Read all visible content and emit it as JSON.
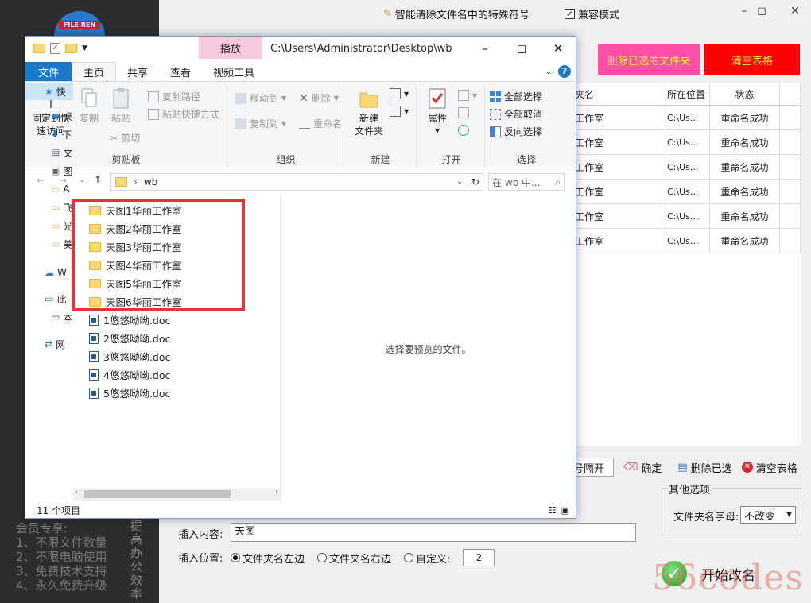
{
  "app": {
    "logo_text": "FILE REN",
    "special_symbols_label": "智能清除文件名中的特殊符号",
    "compat_mode_label": "兼容模式",
    "compat_mode_checked": true,
    "delete_selected_folders": "删除已选的文件夹",
    "clear_table_top": "清空表格",
    "table": {
      "headers": [
        "夹名",
        "所在位置",
        "状态"
      ],
      "rows": [
        {
          "name": "工作室",
          "location": "C:\\Us...",
          "status": "重命名成功"
        },
        {
          "name": "工作室",
          "location": "C:\\Us...",
          "status": "重命名成功"
        },
        {
          "name": "工作室",
          "location": "C:\\Us...",
          "status": "重命名成功"
        },
        {
          "name": "工作室",
          "location": "C:\\Us...",
          "status": "重命名成功"
        },
        {
          "name": "工作室",
          "location": "C:\\Us...",
          "status": "重命名成功"
        },
        {
          "name": "工作室",
          "location": "C:\\Us...",
          "status": "重命名成功"
        }
      ]
    },
    "toolbar": {
      "separator_value": "号隔开",
      "confirm": "确定",
      "delete_selected": "删除已选",
      "clear_table": "清空表格"
    },
    "other_options": {
      "legend": "其他选项",
      "font_label": "文件夹名字母:",
      "font_value": "不改变"
    },
    "insert": {
      "content_label": "插入内容:",
      "content_value": "天图",
      "position_label": "插入位置:",
      "option_left": "文件夹名左边",
      "option_right": "文件夹名右边",
      "option_custom": "自定义:",
      "custom_value": "2",
      "selected": "left"
    },
    "start_label": "开始改名",
    "vip_lines": [
      "会员专享:",
      "1、不限文件数量",
      "2、不限电脑使用",
      "3、免费技术支持",
      "4、永久免费升级"
    ],
    "slogan_vertical": "提高办公效率",
    "watermark": "56codes"
  },
  "explorer": {
    "title_path": "C:\\Users\\Administrator\\Desktop\\wb",
    "context_tab": "播放",
    "tabs": [
      "文件",
      "主页",
      "共享",
      "查看",
      "视频工具"
    ],
    "ribbon": {
      "pin_quick": "固定到快\n速访问",
      "copy": "复制",
      "paste": "粘贴",
      "copy_path": "复制路径",
      "paste_shortcut": "粘贴快捷方式",
      "cut": "剪切",
      "group_clipboard": "剪贴板",
      "move_to": "移动到",
      "copy_to": "复制到",
      "delete": "删除",
      "rename": "重命名",
      "group_organize": "组织",
      "new_folder": "新建\n文件夹",
      "group_new": "新建",
      "properties": "属性",
      "group_open": "打开",
      "select_all": "全部选择",
      "select_none": "全部取消",
      "invert_selection": "反向选择",
      "group_select": "选择"
    },
    "address": "wb",
    "search_placeholder": "在 wb 中...",
    "nav_items": [
      "快",
      "桌",
      "下",
      "文",
      "图",
      "A",
      "飞",
      "光",
      "美",
      "W",
      "此",
      "本",
      "网"
    ],
    "files": [
      {
        "name": "天图1华丽工作室",
        "type": "folder"
      },
      {
        "name": "天图2华丽工作室",
        "type": "folder"
      },
      {
        "name": "天图3华丽工作室",
        "type": "folder"
      },
      {
        "name": "天图4华丽工作室",
        "type": "folder"
      },
      {
        "name": "天图5华丽工作室",
        "type": "folder"
      },
      {
        "name": "天图6华丽工作室",
        "type": "folder"
      },
      {
        "name": "1悠悠呦呦.doc",
        "type": "doc"
      },
      {
        "name": "2悠悠呦呦.doc",
        "type": "doc"
      },
      {
        "name": "3悠悠呦呦.doc",
        "type": "doc"
      },
      {
        "name": "4悠悠呦呦.doc",
        "type": "doc"
      },
      {
        "name": "5悠悠呦呦.doc",
        "type": "doc"
      }
    ],
    "preview_text": "选择要预览的文件。",
    "status_count": "11 个项目"
  },
  "colors": {
    "accent_blue": "#1979ca",
    "highlight_red": "#e0353b",
    "btn_pink": "#ff4fa6",
    "btn_red": "#ff0000",
    "btn_text_yellow": "#ffef3c"
  }
}
